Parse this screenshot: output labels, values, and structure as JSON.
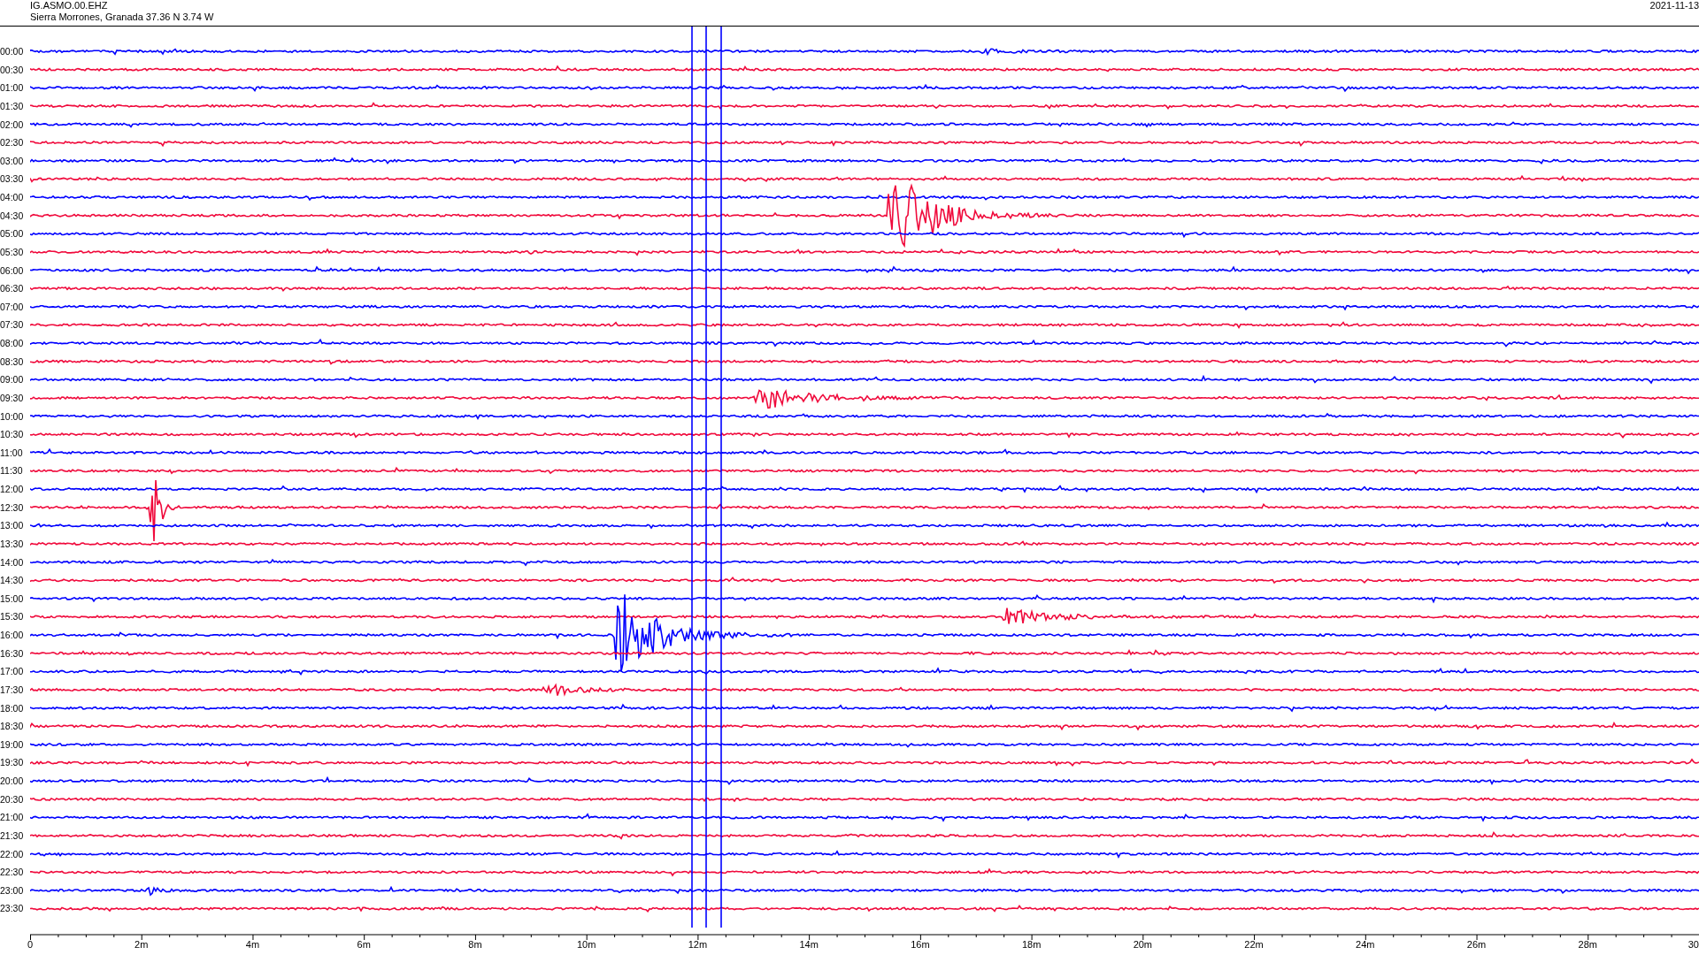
{
  "header": {
    "station": "IG.ASMO.00.EHZ",
    "location": "Sierra Morrones, Granada  37.36 N 3.74 W",
    "date": "2021-11-13"
  },
  "rows": [
    {
      "time": "00:00",
      "color": "#0000ff"
    },
    {
      "time": "00:30",
      "color": "#f00a3c"
    },
    {
      "time": "01:00",
      "color": "#0000ff"
    },
    {
      "time": "01:30",
      "color": "#f00a3c"
    },
    {
      "time": "02:00",
      "color": "#0000ff"
    },
    {
      "time": "02:30",
      "color": "#f00a3c"
    },
    {
      "time": "03:00",
      "color": "#0000ff"
    },
    {
      "time": "03:30",
      "color": "#f00a3c"
    },
    {
      "time": "04:00",
      "color": "#0000ff"
    },
    {
      "time": "04:30",
      "color": "#f00a3c"
    },
    {
      "time": "05:00",
      "color": "#0000ff"
    },
    {
      "time": "05:30",
      "color": "#f00a3c"
    },
    {
      "time": "06:00",
      "color": "#0000ff"
    },
    {
      "time": "06:30",
      "color": "#f00a3c"
    },
    {
      "time": "07:00",
      "color": "#0000ff"
    },
    {
      "time": "07:30",
      "color": "#f00a3c"
    },
    {
      "time": "08:00",
      "color": "#0000ff"
    },
    {
      "time": "08:30",
      "color": "#f00a3c"
    },
    {
      "time": "09:00",
      "color": "#0000ff"
    },
    {
      "time": "09:30",
      "color": "#f00a3c"
    },
    {
      "time": "10:00",
      "color": "#0000ff"
    },
    {
      "time": "10:30",
      "color": "#f00a3c"
    },
    {
      "time": "11:00",
      "color": "#0000ff"
    },
    {
      "time": "11:30",
      "color": "#f00a3c"
    },
    {
      "time": "12:00",
      "color": "#0000ff"
    },
    {
      "time": "12:30",
      "color": "#f00a3c"
    },
    {
      "time": "13:00",
      "color": "#0000ff"
    },
    {
      "time": "13:30",
      "color": "#f00a3c"
    },
    {
      "time": "14:00",
      "color": "#0000ff"
    },
    {
      "time": "14:30",
      "color": "#f00a3c"
    },
    {
      "time": "15:00",
      "color": "#0000ff"
    },
    {
      "time": "15:30",
      "color": "#f00a3c"
    },
    {
      "time": "16:00",
      "color": "#0000ff"
    },
    {
      "time": "16:30",
      "color": "#f00a3c"
    },
    {
      "time": "17:00",
      "color": "#0000ff"
    },
    {
      "time": "17:30",
      "color": "#f00a3c"
    },
    {
      "time": "18:00",
      "color": "#0000ff"
    },
    {
      "time": "18:30",
      "color": "#f00a3c"
    },
    {
      "time": "19:00",
      "color": "#0000ff"
    },
    {
      "time": "19:30",
      "color": "#f00a3c"
    },
    {
      "time": "20:00",
      "color": "#0000ff"
    },
    {
      "time": "20:30",
      "color": "#f00a3c"
    },
    {
      "time": "21:00",
      "color": "#0000ff"
    },
    {
      "time": "21:30",
      "color": "#f00a3c"
    },
    {
      "time": "22:00",
      "color": "#0000ff"
    },
    {
      "time": "22:30",
      "color": "#f00a3c"
    },
    {
      "time": "23:00",
      "color": "#0000ff"
    },
    {
      "time": "23:30",
      "color": "#f00a3c"
    }
  ],
  "x_axis": {
    "tick_labels": [
      "0",
      "2m",
      "4m",
      "6m",
      "8m",
      "10m",
      "12m",
      "14m",
      "16m",
      "18m",
      "20m",
      "22m",
      "24m",
      "26m",
      "28m",
      "30"
    ]
  }
}
